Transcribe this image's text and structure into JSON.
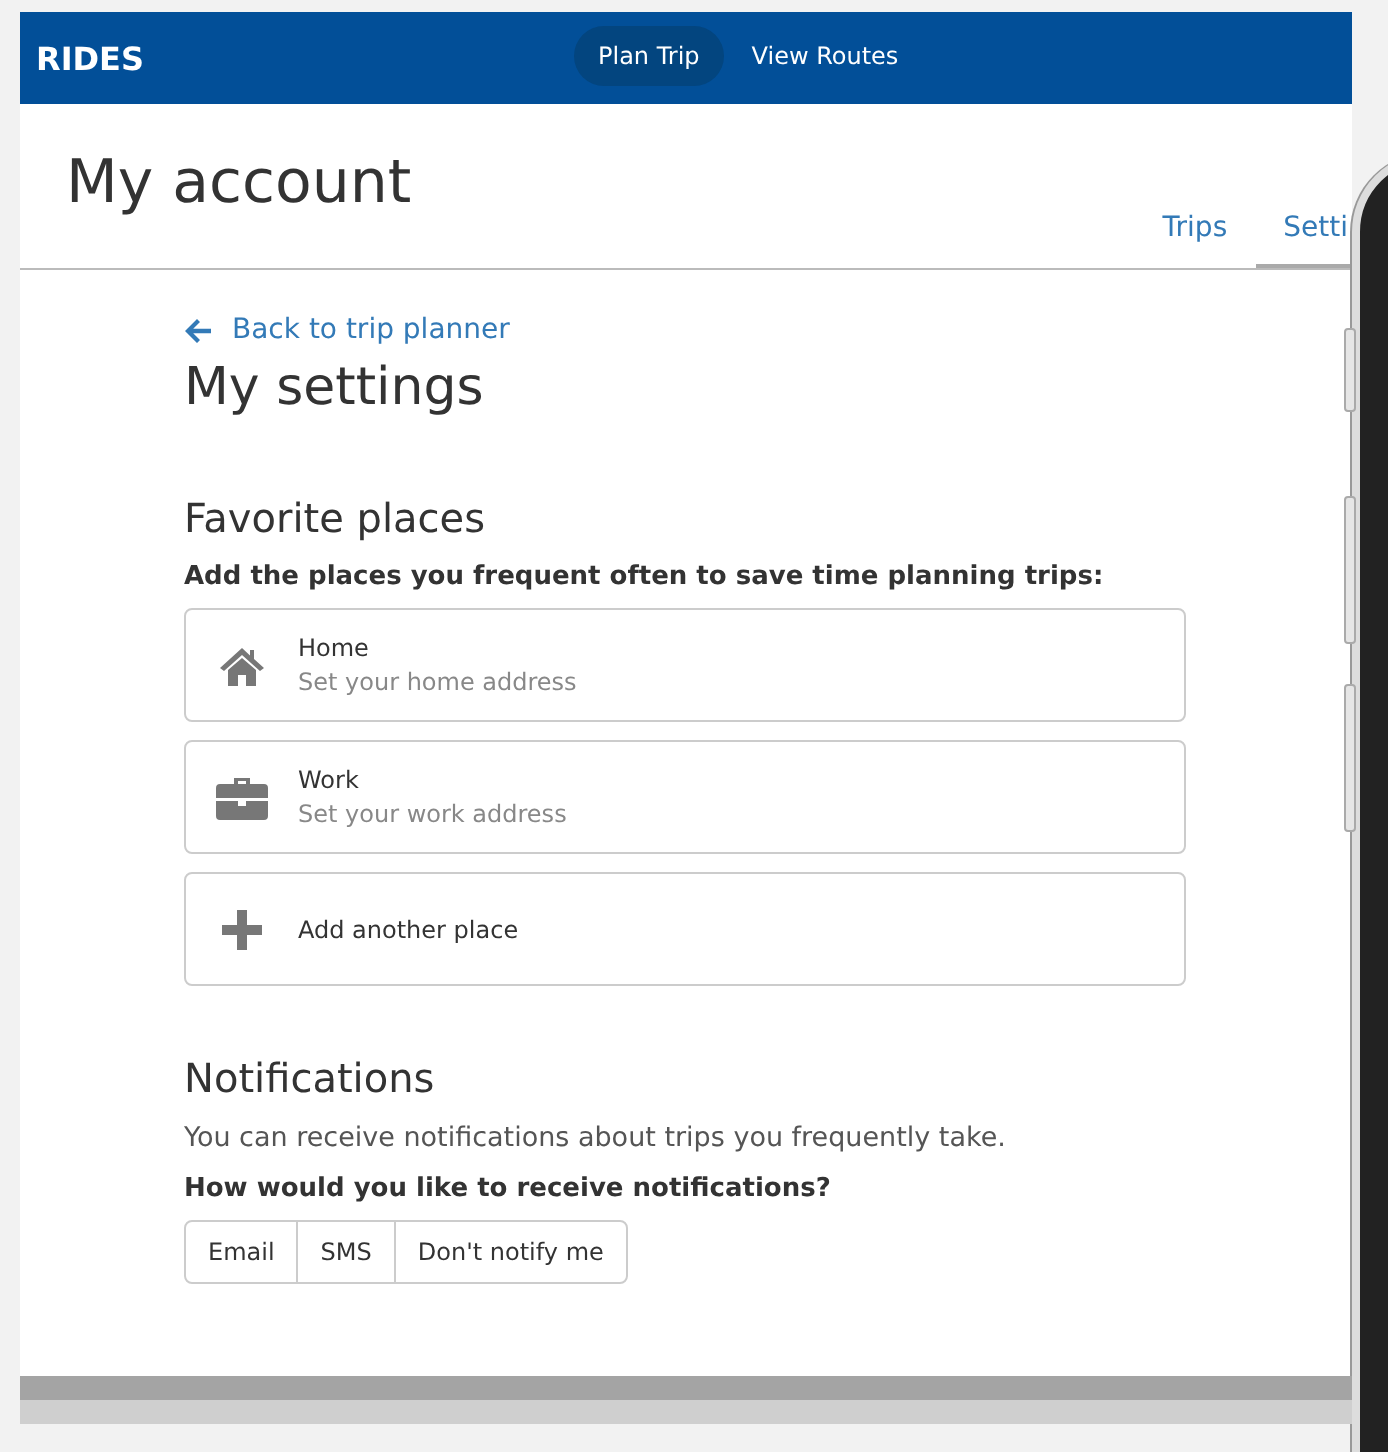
{
  "header": {
    "brand": "RIDES",
    "nav": [
      {
        "label": "Plan Trip",
        "selected": true
      },
      {
        "label": "View Routes",
        "selected": false
      }
    ]
  },
  "account": {
    "title": "My account",
    "tabs": [
      {
        "label": "Trips",
        "selected": false
      },
      {
        "label": "Setti",
        "selected": true
      }
    ]
  },
  "back_link": "Back to trip planner",
  "title": "My settings",
  "favorites": {
    "heading": "Favorite places",
    "prompt": "Add the places you frequent often to save time planning trips:",
    "places": [
      {
        "kind": "home",
        "name": "Home",
        "placeholder": "Set your home address"
      },
      {
        "kind": "work",
        "name": "Work",
        "placeholder": "Set your work address"
      },
      {
        "kind": "add",
        "name": "Add another place"
      }
    ]
  },
  "notifications": {
    "heading": "Notifications",
    "description": "You can receive notifications about trips you frequently take.",
    "question": "How would you like to receive notifications?",
    "options": [
      "Email",
      "SMS",
      "Don't notify me"
    ]
  }
}
